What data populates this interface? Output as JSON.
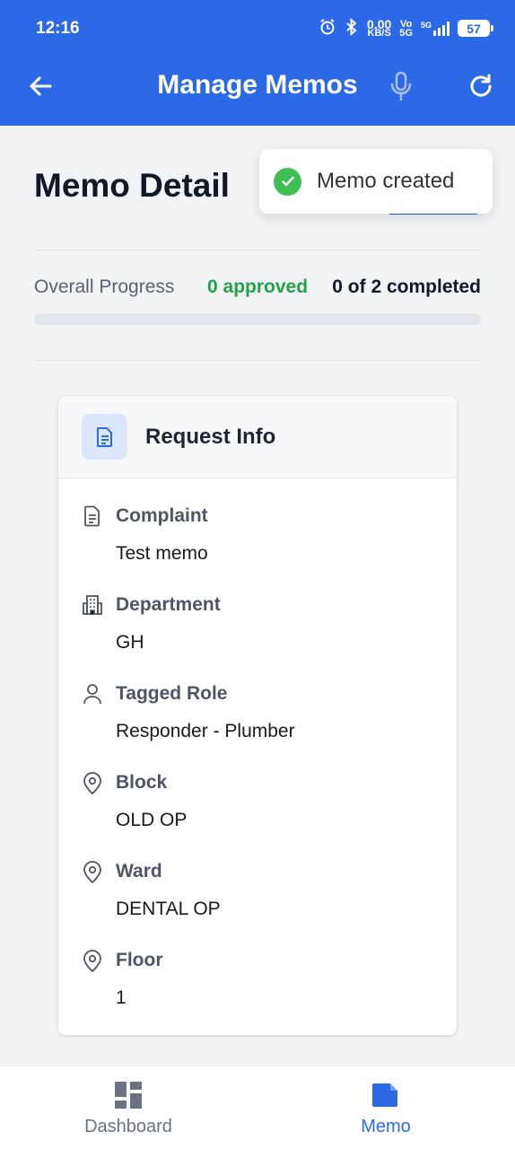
{
  "status_bar": {
    "time": "12:16",
    "speed_value": "0.00",
    "speed_unit": "KB/S",
    "volte_top": "Vo",
    "volte_bottom": "5G",
    "network": "5G",
    "battery": "57"
  },
  "app_bar": {
    "title": "Manage Memos",
    "back_icon": "arrow-left-icon",
    "mic_icon": "microphone-icon",
    "refresh_icon": "refresh-icon"
  },
  "page": {
    "title": "Memo Detail"
  },
  "toast": {
    "message": "Memo created",
    "icon": "check-circle-icon"
  },
  "progress": {
    "label": "Overall Progress",
    "approved": "0 approved",
    "completed": "0 of 2 completed",
    "fraction": 0
  },
  "request_info": {
    "title": "Request Info",
    "fields": [
      {
        "label": "Complaint",
        "value": "Test memo",
        "icon": "document-icon"
      },
      {
        "label": "Department",
        "value": "GH",
        "icon": "building-icon"
      },
      {
        "label": "Tagged Role",
        "value": "Responder - Plumber",
        "icon": "user-icon"
      },
      {
        "label": "Block",
        "value": "OLD OP",
        "icon": "location-pin-icon"
      },
      {
        "label": "Ward",
        "value": "DENTAL OP",
        "icon": "location-pin-icon"
      },
      {
        "label": "Floor",
        "value": "1",
        "icon": "location-pin-icon"
      }
    ]
  },
  "bottom_nav": {
    "items": [
      {
        "label": "Dashboard",
        "icon": "dashboard-grid-icon",
        "active": false
      },
      {
        "label": "Memo",
        "icon": "memo-icon",
        "active": true
      }
    ]
  },
  "colors": {
    "primary": "#2b69e6",
    "success": "#22a34a",
    "toast_check": "#3fbe52",
    "inactive_nav": "#6b7280"
  }
}
